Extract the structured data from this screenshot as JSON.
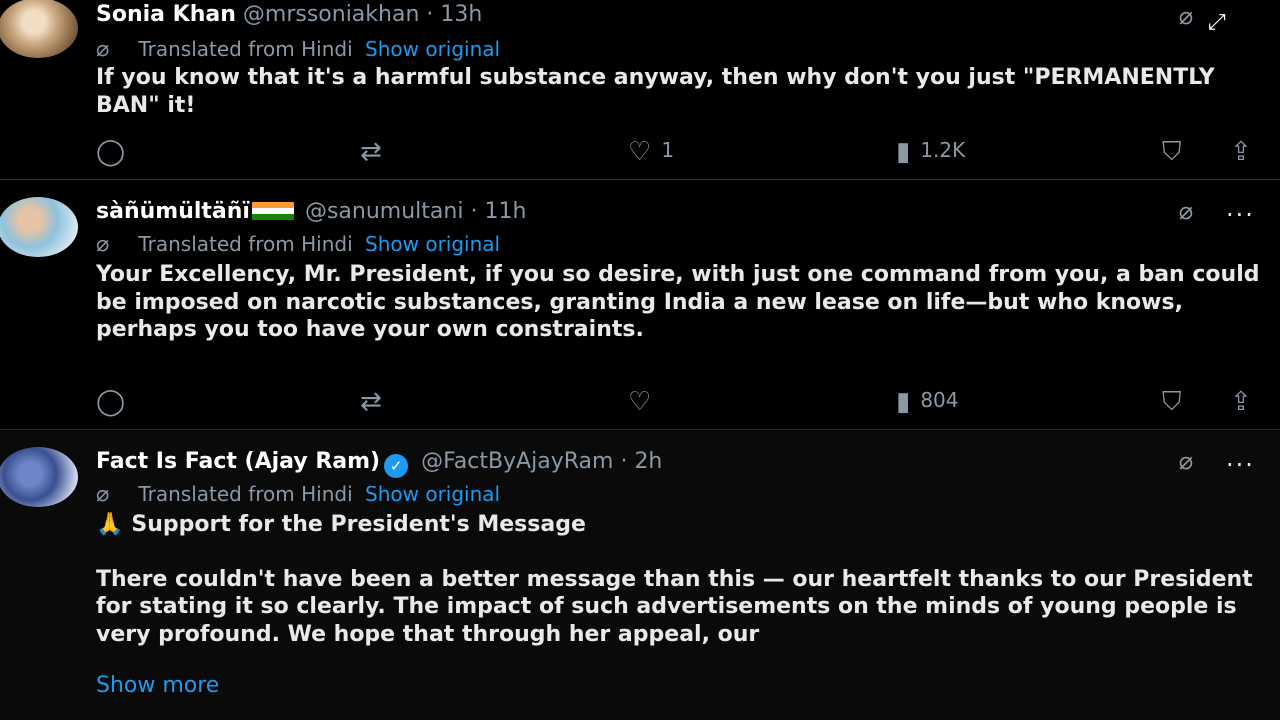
{
  "common": {
    "translated_label": "Translated from Hindi",
    "show_original_label": "Show original",
    "dot": "·"
  },
  "icons": {
    "reply": "reply-icon",
    "retweet": "retweet-icon",
    "like": "heart-icon",
    "views": "views-icon",
    "bookmark": "bookmark-icon",
    "share": "share-icon",
    "translate": "translate-icon",
    "grok": "grok-icon",
    "more": "more-icon",
    "expand": "expand-icon"
  },
  "colors": {
    "background": "#000000",
    "text": "#e7e9ea",
    "muted": "#8b98a5",
    "link": "#1d9bf0",
    "divider": "#2f3336"
  },
  "tweets": [
    {
      "name": "Sonia Khan",
      "handle": "@mrssoniakhan",
      "time": "13h",
      "body": [
        "If you know that it's a harmful substance anyway, then why don't you just \"PERMANENTLY BAN\" it!"
      ],
      "reply_count": "",
      "retweet_count": "",
      "like_count": "1",
      "views_count": "1.2K"
    },
    {
      "name": "sàñümültäñï",
      "handle": "@sanumultani",
      "time": "11h",
      "body": [
        "Your Excellency, Mr. President, if you so desire, with just one command from you, a ban could be imposed on narcotic substances, granting India a new lease on life—but who knows, perhaps you too have your own constraints."
      ],
      "reply_count": "",
      "retweet_count": "",
      "like_count": "",
      "views_count": "804"
    },
    {
      "name": "Fact Is Fact (Ajay Ram)",
      "handle": "@FactByAjayRam",
      "time": "2h",
      "emoji": "🙏",
      "heading": "Support for the President's Message",
      "body": [
        "There couldn't have been a better message than this — our heartfelt thanks to our President for stating it so clearly. The impact of such advertisements on the minds of young people is very profound. We hope that through her appeal, our"
      ],
      "show_more": "Show more"
    }
  ]
}
